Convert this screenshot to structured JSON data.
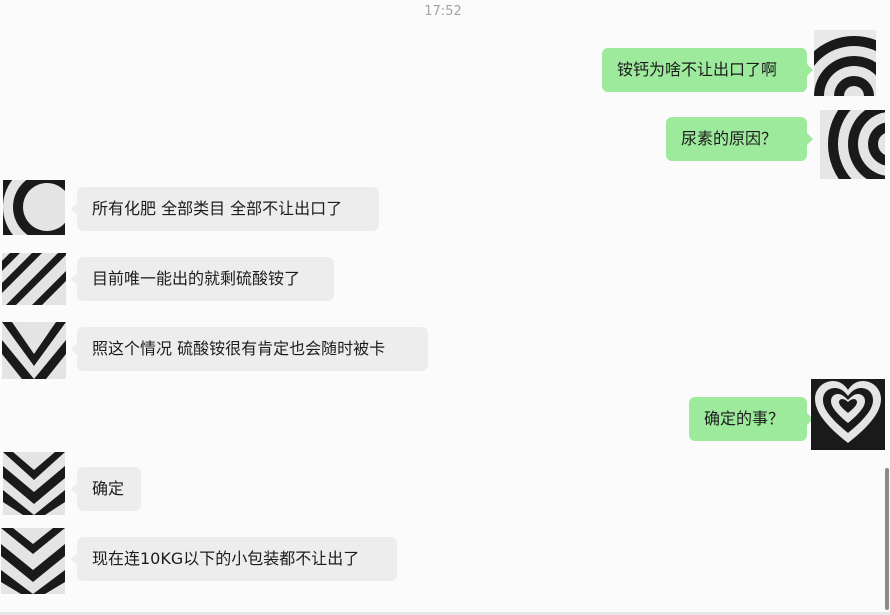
{
  "chat": {
    "timestamp": "17:52",
    "messages": [
      {
        "side": "out",
        "text": "铵钙为啥不让出口了啊",
        "avatar": "concentric-rings-avatar"
      },
      {
        "side": "out",
        "text": "尿素的原因？",
        "avatar": "concentric-rings-avatar"
      },
      {
        "side": "in",
        "text": "所有化肥 全部类目 全部不让出口了",
        "avatar": "concentric-rings-avatar"
      },
      {
        "side": "in",
        "text": "目前唯一能出的就剩硫酸铵了",
        "avatar": "diagonal-stripes-avatar"
      },
      {
        "side": "in",
        "text": "照这个情况 硫酸铵很有肯定也会随时被卡",
        "avatar": "chevron-stripes-avatar"
      },
      {
        "side": "out",
        "text": "确定的事？",
        "avatar": "heart-avatar"
      },
      {
        "side": "in",
        "text": "确定",
        "avatar": "chevron-stripes-avatar"
      },
      {
        "side": "in",
        "text": "现在连10KG以下的小包装都不让出了",
        "avatar": "chevron-stripes-avatar"
      }
    ]
  }
}
